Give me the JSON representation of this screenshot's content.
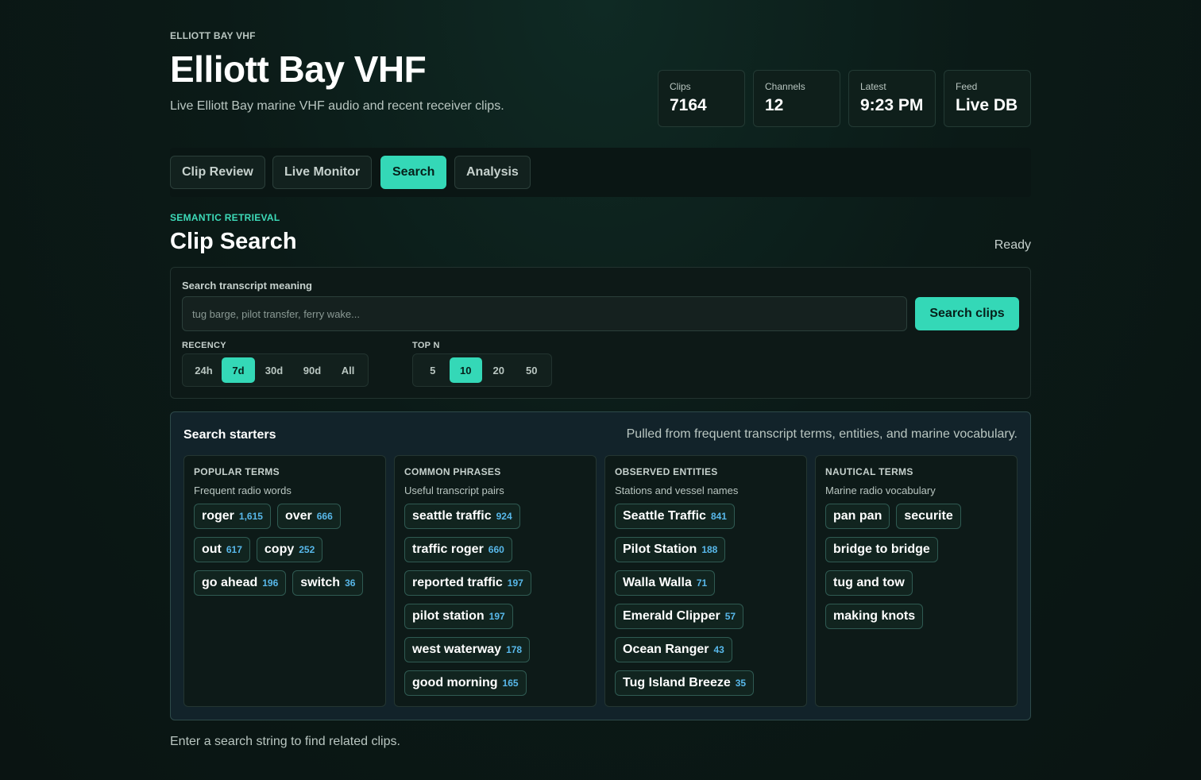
{
  "header": {
    "eyebrow": "ELLIOTT BAY VHF",
    "title": "Elliott Bay VHF",
    "subtitle": "Live Elliott Bay marine VHF audio and recent receiver clips."
  },
  "stats": [
    {
      "label": "Clips",
      "value": "7164"
    },
    {
      "label": "Channels",
      "value": "12"
    },
    {
      "label": "Latest",
      "value": "9:23 PM"
    },
    {
      "label": "Feed",
      "value": "Live DB"
    }
  ],
  "tabs": [
    {
      "label": "Clip Review",
      "active": false
    },
    {
      "label": "Live Monitor",
      "active": false
    },
    {
      "label": "Search",
      "active": true
    },
    {
      "label": "Analysis",
      "active": false
    }
  ],
  "section": {
    "eyebrow": "SEMANTIC RETRIEVAL",
    "title": "Clip Search",
    "status": "Ready"
  },
  "search": {
    "label": "Search transcript meaning",
    "placeholder": "tug barge, pilot transfer, ferry wake...",
    "value": "",
    "button": "Search clips"
  },
  "recency": {
    "label": "RECENCY",
    "options": [
      "24h",
      "7d",
      "30d",
      "90d",
      "All"
    ],
    "selected": "7d"
  },
  "topn": {
    "label": "TOP N",
    "options": [
      "5",
      "10",
      "20",
      "50"
    ],
    "selected": "10"
  },
  "starters": {
    "title": "Search starters",
    "note": "Pulled from frequent transcript terms, entities, and marine vocabulary.",
    "columns": [
      {
        "title": "POPULAR TERMS",
        "subtitle": "Frequent radio words",
        "chips": [
          {
            "text": "roger",
            "count": "1,615"
          },
          {
            "text": "over",
            "count": "666"
          },
          {
            "text": "out",
            "count": "617"
          },
          {
            "text": "copy",
            "count": "252"
          },
          {
            "text": "go ahead",
            "count": "196"
          },
          {
            "text": "switch",
            "count": "36"
          }
        ]
      },
      {
        "title": "COMMON PHRASES",
        "subtitle": "Useful transcript pairs",
        "chips": [
          {
            "text": "seattle traffic",
            "count": "924"
          },
          {
            "text": "traffic roger",
            "count": "660"
          },
          {
            "text": "reported traffic",
            "count": "197"
          },
          {
            "text": "pilot station",
            "count": "197"
          },
          {
            "text": "west waterway",
            "count": "178"
          },
          {
            "text": "good morning",
            "count": "165"
          }
        ]
      },
      {
        "title": "OBSERVED ENTITIES",
        "subtitle": "Stations and vessel names",
        "chips": [
          {
            "text": "Seattle Traffic",
            "count": "841"
          },
          {
            "text": "Pilot Station",
            "count": "188"
          },
          {
            "text": "Walla Walla",
            "count": "71"
          },
          {
            "text": "Emerald Clipper",
            "count": "57"
          },
          {
            "text": "Ocean Ranger",
            "count": "43"
          },
          {
            "text": "Tug Island Breeze",
            "count": "35"
          }
        ]
      },
      {
        "title": "NAUTICAL TERMS",
        "subtitle": "Marine radio vocabulary",
        "chips": [
          {
            "text": "pan pan",
            "count": ""
          },
          {
            "text": "securite",
            "count": ""
          },
          {
            "text": "bridge to bridge",
            "count": ""
          },
          {
            "text": "tug and tow",
            "count": ""
          },
          {
            "text": "making knots",
            "count": ""
          }
        ]
      }
    ]
  },
  "footer": "Enter a search string to find related clips.",
  "colors": {
    "accent": "#34d8b7",
    "count": "#58b8ea",
    "background": "#0b1a17"
  }
}
